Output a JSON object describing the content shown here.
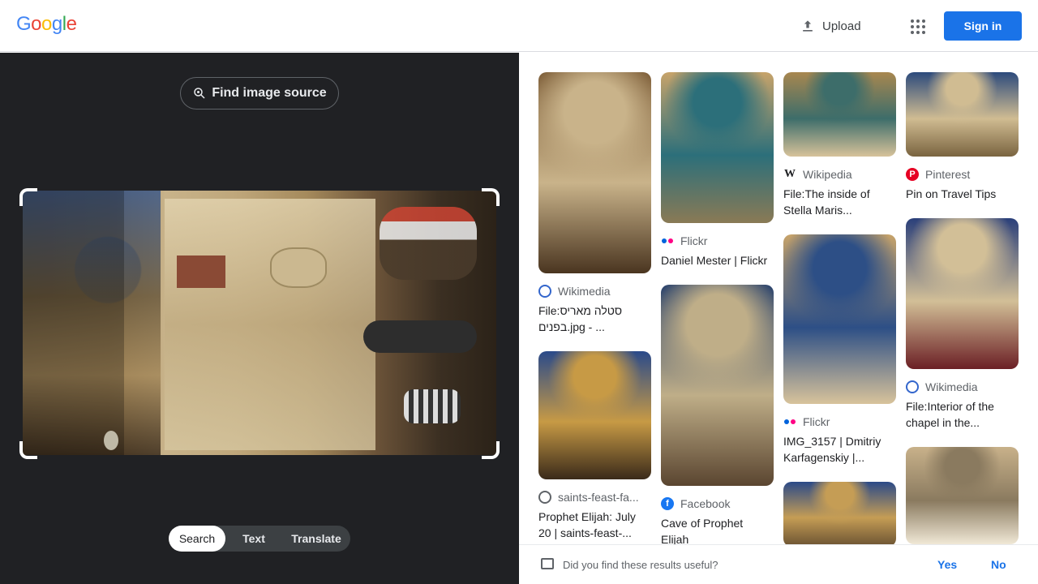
{
  "header": {
    "logo_letters": [
      {
        "char": "G",
        "color": "#4285f4"
      },
      {
        "char": "o",
        "color": "#ea4335"
      },
      {
        "char": "o",
        "color": "#fbbc05"
      },
      {
        "char": "g",
        "color": "#4285f4"
      },
      {
        "char": "l",
        "color": "#34a853"
      },
      {
        "char": "e",
        "color": "#ea4335"
      }
    ],
    "upload_label": "Upload",
    "signin_label": "Sign in"
  },
  "left": {
    "find_source_label": "Find image source",
    "modes": [
      "Search",
      "Text",
      "Translate"
    ],
    "active_mode": "Search"
  },
  "results": {
    "columns": [
      [
        {
          "source": "Wikimedia",
          "icon": "wikimedia-icon",
          "title": "File:סטלה מאריס בפנים.jpg - ...",
          "thumb_colors": [
            "#7a5a35",
            "#c9b38a",
            "#4a3520"
          ]
        },
        {
          "source": "saints-feast-fa...",
          "icon": "globe-icon",
          "title": "Prophet Elijah: July 20 | saints-feast-...",
          "thumb_colors": [
            "#2a4a8a",
            "#c79a45",
            "#3a2a1a"
          ]
        }
      ],
      [
        {
          "source": "Flickr",
          "icon": "flickr-icon",
          "title": "Daniel Mester | Flickr",
          "thumb_colors": [
            "#c7a36a",
            "#2c6f7a",
            "#8a7a55"
          ]
        },
        {
          "source": "Facebook",
          "icon": "facebook-icon",
          "title": "Cave of Prophet Elijah",
          "thumb_colors": [
            "#1e3a6a",
            "#bfae88",
            "#5a4530"
          ]
        }
      ],
      [
        {
          "source": "Wikipedia",
          "icon": "wikipedia-icon",
          "title": "File:The inside of Stella Maris...",
          "thumb_colors": [
            "#a8874f",
            "#3d6d6a",
            "#d7c29a"
          ]
        },
        {
          "source": "Flickr",
          "icon": "flickr-icon",
          "title": "IMG_3157 | Dmitriy Karfagenskiy |...",
          "thumb_colors": [
            "#c7a36a",
            "#2d4f86",
            "#d8c39b"
          ]
        },
        {
          "source": "",
          "icon": "",
          "title": "",
          "thumb_colors": [
            "#2b4a88",
            "#c59d55",
            "#6a5232"
          ]
        }
      ],
      [
        {
          "source": "Pinterest",
          "icon": "pinterest-icon",
          "title": "Pin on Travel Tips",
          "thumb_colors": [
            "#2c4a7c",
            "#d0bc92",
            "#7a6440"
          ]
        },
        {
          "source": "Wikimedia",
          "icon": "wikimedia-icon",
          "title": "File:Interior of the chapel in the...",
          "thumb_colors": [
            "#2a3f7a",
            "#d2bf97",
            "#6b1f25"
          ]
        },
        {
          "source": "",
          "icon": "",
          "title": "",
          "thumb_colors": [
            "#c8b18a",
            "#8a7a5f",
            "#f0e8d6"
          ]
        }
      ]
    ]
  },
  "feedback": {
    "question": "Did you find these results useful?",
    "yes": "Yes",
    "no": "No"
  }
}
